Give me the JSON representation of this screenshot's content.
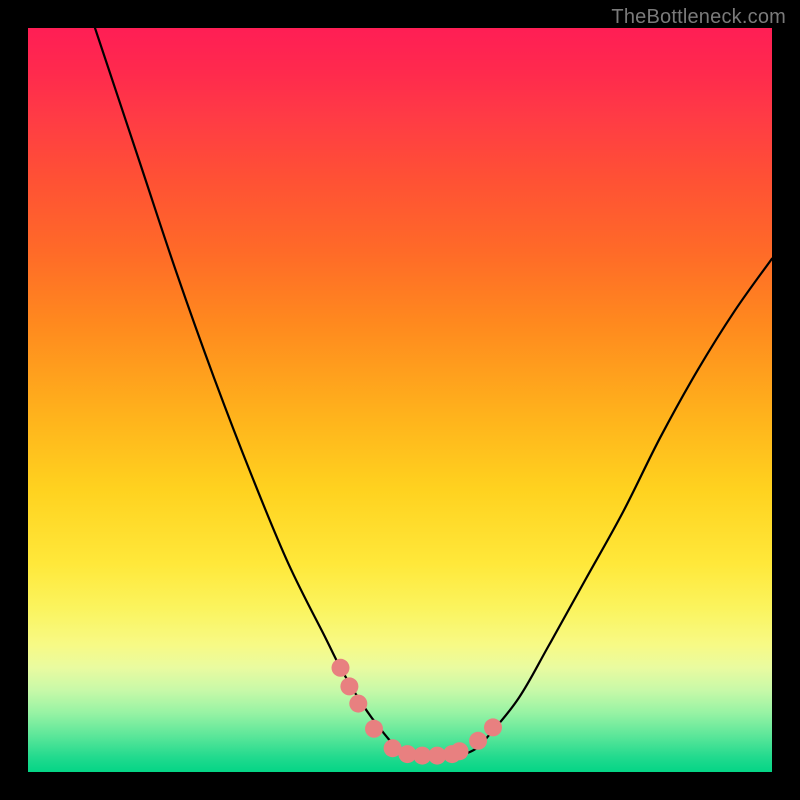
{
  "watermark": "TheBottleneck.com",
  "chart_data": {
    "type": "line",
    "title": "",
    "xlabel": "",
    "ylabel": "",
    "xlim": [
      0,
      100
    ],
    "ylim": [
      0,
      100
    ],
    "series": [
      {
        "name": "bottleneck-curve",
        "x": [
          9,
          15,
          20,
          25,
          30,
          35,
          40,
          42,
          45,
          48,
          50,
          53,
          55,
          57,
          60,
          62,
          66,
          70,
          75,
          80,
          85,
          90,
          95,
          100
        ],
        "values": [
          100,
          82,
          67,
          53,
          40,
          28,
          18,
          14,
          9,
          5,
          3,
          2,
          2,
          2,
          3,
          5,
          10,
          17,
          26,
          35,
          45,
          54,
          62,
          69
        ]
      }
    ],
    "markers": {
      "name": "highlight-segments",
      "color": "#e88080",
      "points": [
        {
          "x": 42.0,
          "y": 14.0
        },
        {
          "x": 43.2,
          "y": 11.5
        },
        {
          "x": 44.4,
          "y": 9.2
        },
        {
          "x": 46.5,
          "y": 5.8
        },
        {
          "x": 49.0,
          "y": 3.2
        },
        {
          "x": 51.0,
          "y": 2.4
        },
        {
          "x": 53.0,
          "y": 2.2
        },
        {
          "x": 55.0,
          "y": 2.2
        },
        {
          "x": 57.0,
          "y": 2.4
        },
        {
          "x": 58.0,
          "y": 2.8
        },
        {
          "x": 60.5,
          "y": 4.2
        },
        {
          "x": 62.5,
          "y": 6.0
        }
      ]
    }
  }
}
